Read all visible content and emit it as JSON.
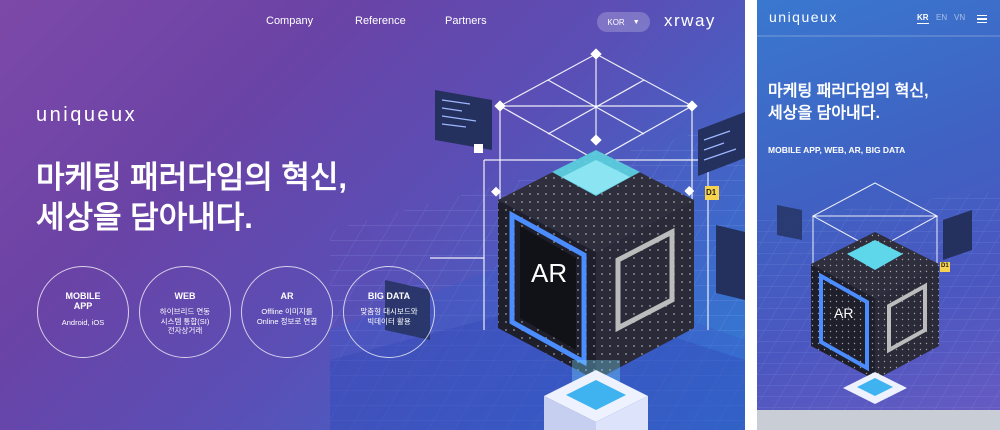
{
  "desktop": {
    "nav": [
      "Company",
      "Reference",
      "Partners"
    ],
    "lang": "KOR",
    "partner_logo": "xrway",
    "logo": "uniqueux",
    "headline_1": "마케팅 패러다임의 혁신,",
    "headline_2": "세상을 담아내다.",
    "services": [
      {
        "title": "MOBILE\nAPP",
        "desc": "Android, iOS"
      },
      {
        "title": "WEB",
        "desc": "하이브리드 연동\n시스템 통합(SI)\n전자상거래"
      },
      {
        "title": "AR",
        "desc": "Offline 이미지를\nOnline 정보로 연결"
      },
      {
        "title": "BIG DATA",
        "desc": "맞춤형 대시보드와\n빅데이터 활용"
      }
    ],
    "cube_label": "AR",
    "tag_label": "D1"
  },
  "mobile": {
    "logo": "uniqueux",
    "langs": [
      "KR",
      "EN",
      "VN"
    ],
    "headline_1": "마케팅 패러다임의 혁신,",
    "headline_2": "세상을 담아내다.",
    "subline": "MOBILE APP, WEB, AR, BIG DATA",
    "cube_label": "AR",
    "tag_label": "D1"
  },
  "colors": {
    "accent_cyan": "#64e0f2",
    "brand_purple": "#7d49a8",
    "brand_blue": "#2f7fd6"
  },
  "icons": [
    "chevron-down-icon",
    "menu-icon"
  ]
}
